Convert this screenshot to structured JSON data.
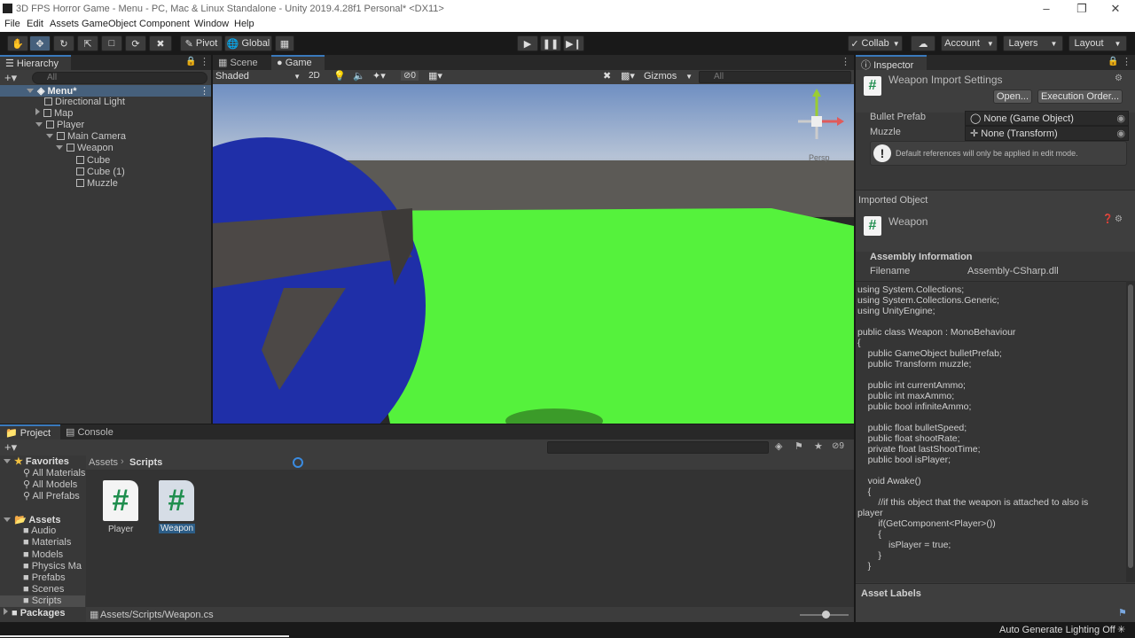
{
  "window": {
    "title": "3D FPS Horror Game - Menu - PC, Mac & Linux Standalone - Unity 2019.4.28f1 Personal* <DX11>"
  },
  "menubar": [
    "File",
    "Edit",
    "Assets",
    "GameObject",
    "Component",
    "Window",
    "Help"
  ],
  "toolbar": {
    "pivot": "Pivot",
    "global": "Global",
    "collab": "Collab",
    "account": "Account",
    "layers": "Layers",
    "layout": "Layout"
  },
  "hierarchy": {
    "tab": "Hierarchy",
    "search_placeholder": "All",
    "scene": "Menu*",
    "items": [
      "Directional Light",
      "Map",
      "Player",
      "Main Camera",
      "Weapon",
      "Cube",
      "Cube (1)",
      "Muzzle"
    ]
  },
  "viewport": {
    "tabs": [
      "Scene",
      "Game"
    ],
    "shading": "Shaded",
    "mode2d": "2D",
    "hidden_count": "0",
    "gizmos": "Gizmos",
    "search_placeholder": "All",
    "persp": "Persp"
  },
  "project": {
    "tabs": [
      "Project",
      "Console"
    ],
    "favorites_label": "Favorites",
    "favorites": [
      "All Materials",
      "All Models",
      "All Prefabs"
    ],
    "assets_label": "Assets",
    "folders": [
      "Audio",
      "Materials",
      "Models",
      "Physics Ma",
      "Prefabs",
      "Scenes",
      "Scripts"
    ],
    "packages_label": "Packages",
    "breadcrumb": [
      "Assets",
      "Scripts"
    ],
    "files": [
      "Player",
      "Weapon"
    ],
    "hidden_count": "9",
    "footer_path": "Assets/Scripts/Weapon.cs"
  },
  "inspector": {
    "tab": "Inspector",
    "header_title": "Weapon Import Settings",
    "open_label": "Open...",
    "exec_order_label": "Execution Order...",
    "fields": [
      {
        "label": "Bullet Prefab",
        "value": "None (Game Object)"
      },
      {
        "label": "Muzzle",
        "value": "None (Transform)"
      }
    ],
    "info_message": "Default references will only be applied in edit mode.",
    "imported_object_label": "Imported Object",
    "imported_name": "Weapon",
    "assembly_title": "Assembly Information",
    "filename_label": "Filename",
    "filename_value": "Assembly-CSharp.dll",
    "code": "using System.Collections;\nusing System.Collections.Generic;\nusing UnityEngine;\n\npublic class Weapon : MonoBehaviour\n{\n    public GameObject bulletPrefab;\n    public Transform muzzle;\n\n    public int currentAmmo;\n    public int maxAmmo;\n    public bool infiniteAmmo;\n\n    public float bulletSpeed;\n    public float shootRate;\n    private float lastShootTime;\n    public bool isPlayer;\n\n    void Awake()\n    {\n        //if this object that the weapon is attached to also is\nplayer\n        if(GetComponent<Player>())\n        {\n            isPlayer = true;\n        }\n    }",
    "asset_labels": "Asset Labels"
  },
  "statusbar": {
    "text": "Auto Generate Lighting Off"
  },
  "colors": {
    "ground": "#55f23c",
    "sphere": "#1f2fa8",
    "accent": "#3a79bb"
  }
}
